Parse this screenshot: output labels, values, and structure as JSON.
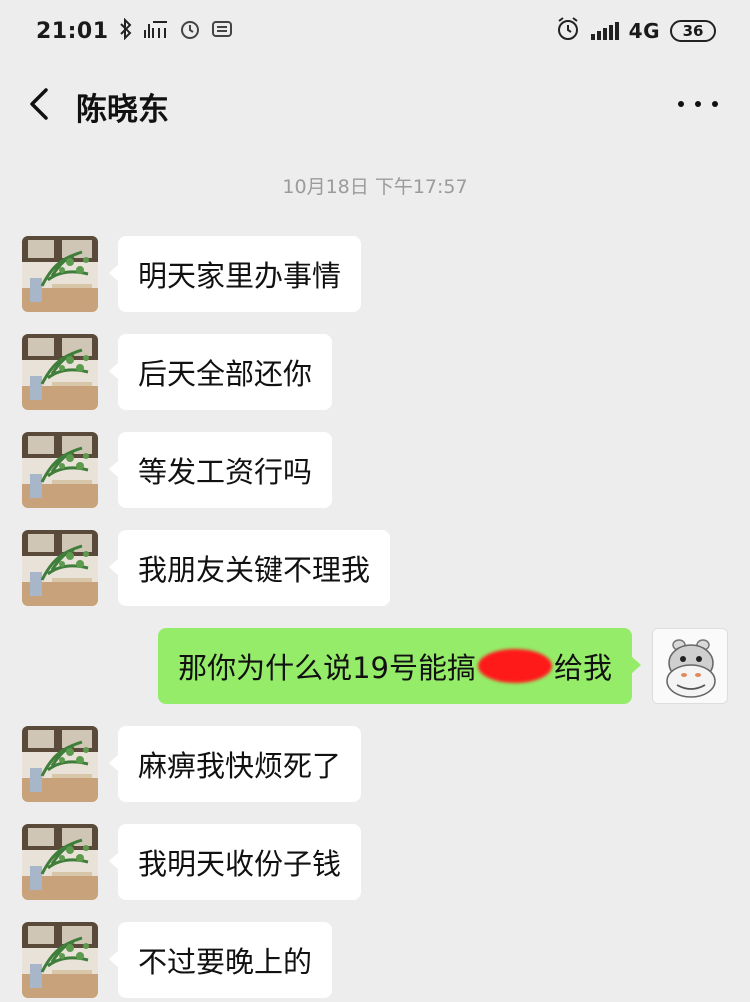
{
  "status_bar": {
    "time": "21:01",
    "network": "4G",
    "battery": "36",
    "icons": [
      "bluetooth-icon",
      "headset-icon",
      "alarm-icon",
      "taobao-icon",
      "alarm-icon",
      "signal-icon"
    ]
  },
  "header": {
    "title": "陈晓东",
    "back_icon": "chevron-left-icon",
    "more_icon": "more-dots-icon"
  },
  "timestamp": "10月18日 下午17:57",
  "messages": [
    {
      "side": "in",
      "text": "明天家里办事情"
    },
    {
      "side": "in",
      "text": "后天全部还你"
    },
    {
      "side": "in",
      "text": "等发工资行吗"
    },
    {
      "side": "in",
      "text": "我朋友关键不理我"
    },
    {
      "side": "out",
      "text_before": "那你为什么说19号能搞",
      "text_after": "给我",
      "redacted": true
    },
    {
      "side": "in",
      "text": "麻痹我快烦死了"
    },
    {
      "side": "in",
      "text": "我明天收份子钱"
    },
    {
      "side": "in",
      "text": "不过要晚上的"
    }
  ],
  "colors": {
    "background": "#ededed",
    "outgoing_bubble": "#95ec69",
    "incoming_bubble": "#ffffff",
    "redaction": "#ff1a1a"
  }
}
